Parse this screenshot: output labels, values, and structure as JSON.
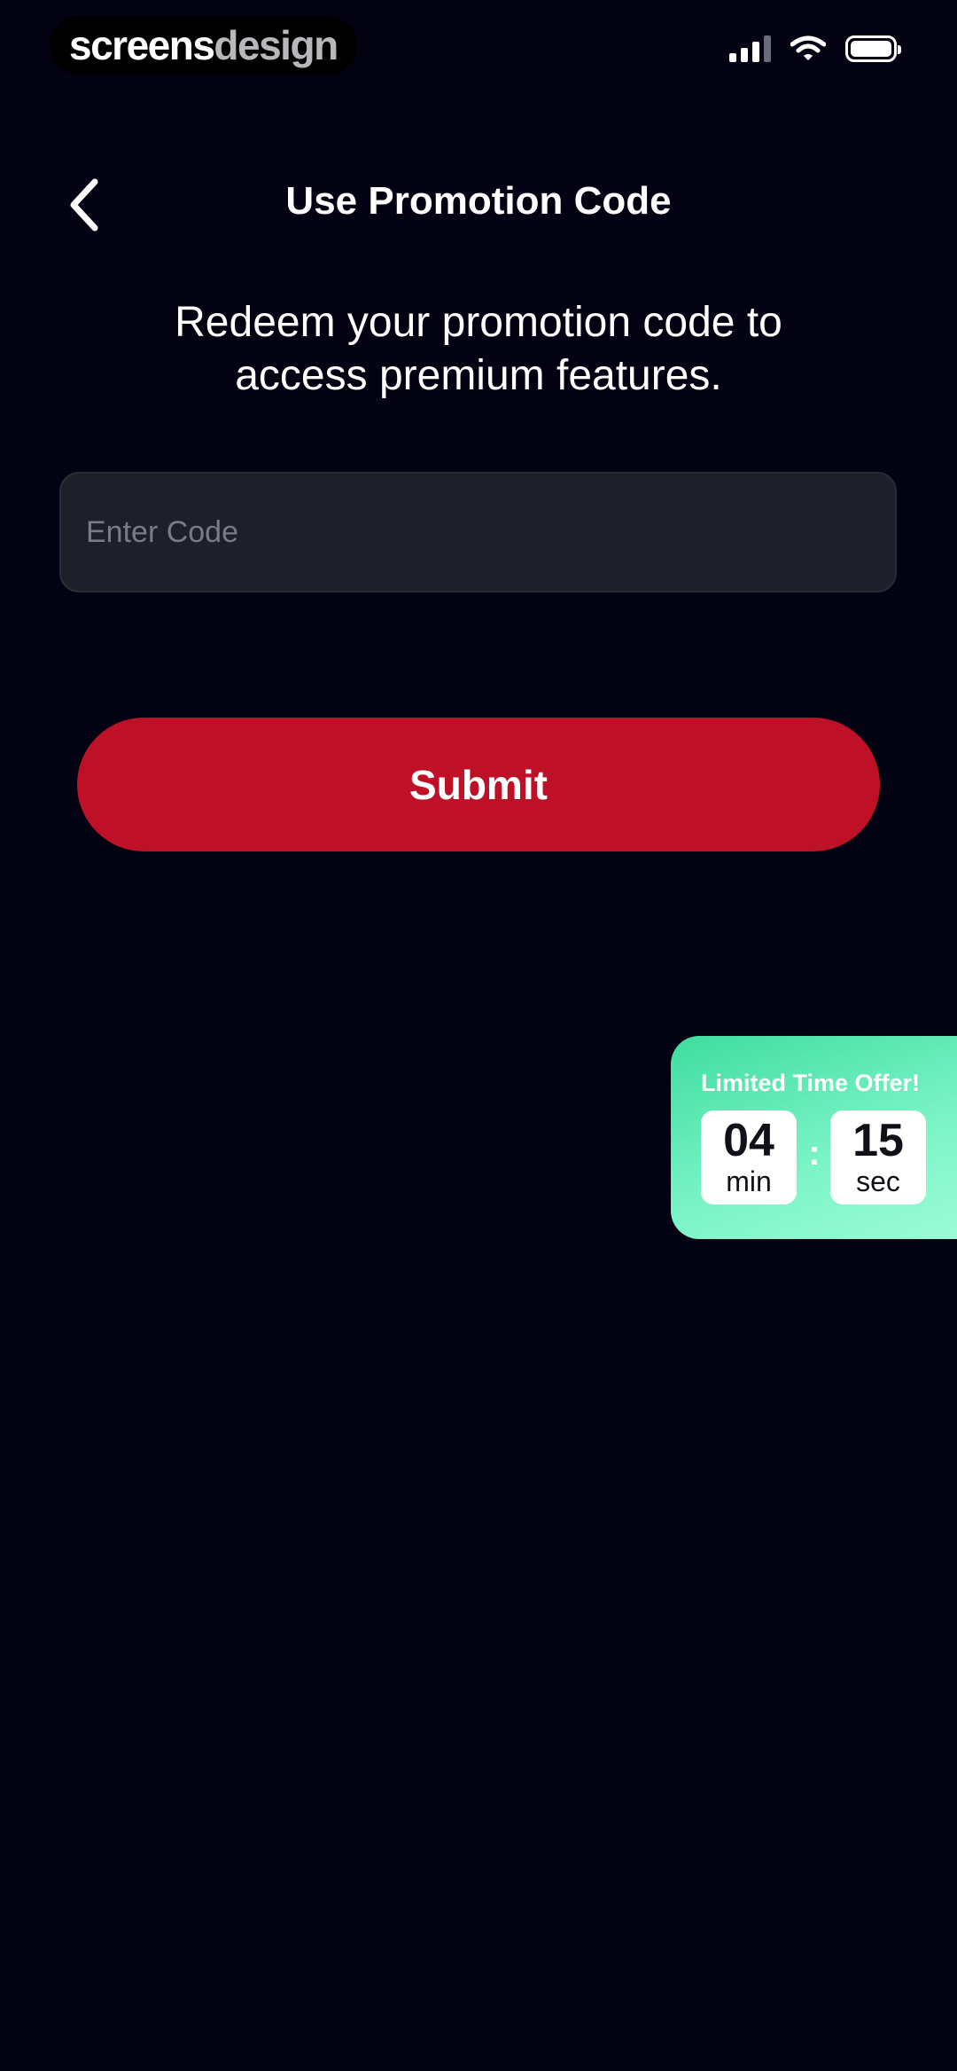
{
  "watermark": {
    "part1": "screens",
    "part2": "design"
  },
  "header": {
    "title": "Use Promotion Code"
  },
  "subtitle": {
    "line1": "Redeem your promotion code to",
    "line2": "access premium features."
  },
  "code_input": {
    "placeholder": "Enter Code",
    "value": ""
  },
  "submit": {
    "label": "Submit"
  },
  "offer": {
    "title": "Limited Time Offer!",
    "minutes": "04",
    "minutes_unit": "min",
    "separator": ":",
    "seconds": "15",
    "seconds_unit": "sec"
  },
  "colors": {
    "background": "#020212",
    "accent": "#be1128",
    "offer_gradient_start": "#3fdd9e",
    "offer_gradient_end": "#9bfbd8",
    "input_bg": "#1f1f2a"
  },
  "icons": {
    "back": "chevron-left-icon",
    "signal": "cellular-signal-icon",
    "wifi": "wifi-icon",
    "battery": "battery-icon"
  }
}
